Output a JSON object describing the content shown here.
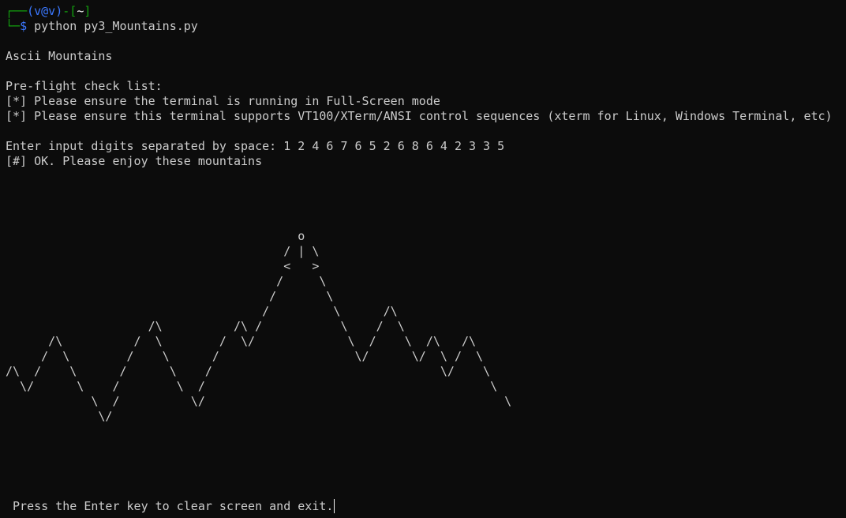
{
  "prompt": {
    "corner_top": "┌──",
    "user_host": "(v@v)",
    "dash": "-",
    "bracket_open": "[",
    "cwd": "~",
    "bracket_close": "]",
    "corner_bottom": "└─",
    "dollar": "$",
    "command": " python py3_Mountains.py"
  },
  "output": {
    "title": "Ascii Mountains",
    "checklist_heading": "Pre-flight check list:",
    "check_1": "[*] Please ensure the terminal is running in Full-Screen mode",
    "check_2": "[*] Please ensure this terminal supports VT100/XTerm/ANSI control sequences (xterm for Linux, Windows Terminal, etc)",
    "input_line": "Enter input digits separated by space: 1 2 4 6 7 6 5 2 6 8 6 4 2 3 3 5",
    "ok_line": "[#] OK. Please enjoy these mountains"
  },
  "mountain_art": [
    "                                         o",
    "                                       / | \\",
    "                                       <   >",
    "                                      /     \\",
    "                                     /       \\",
    "                                    /         \\      /\\",
    "                    /\\          /\\ /           \\    /  \\",
    "      /\\          /  \\        /  \\/             \\  /    \\  /\\   /\\",
    "     /  \\        /    \\      /                   \\/      \\/  \\ /  \\",
    "/\\  /    \\      /      \\    /                                \\/    \\",
    "  \\/      \\    /        \\  /                                        \\",
    "            \\  /          \\/                                          \\",
    "             \\/"
  ],
  "footer": {
    "exit_prompt": " Press the Enter key to clear screen and exit."
  }
}
